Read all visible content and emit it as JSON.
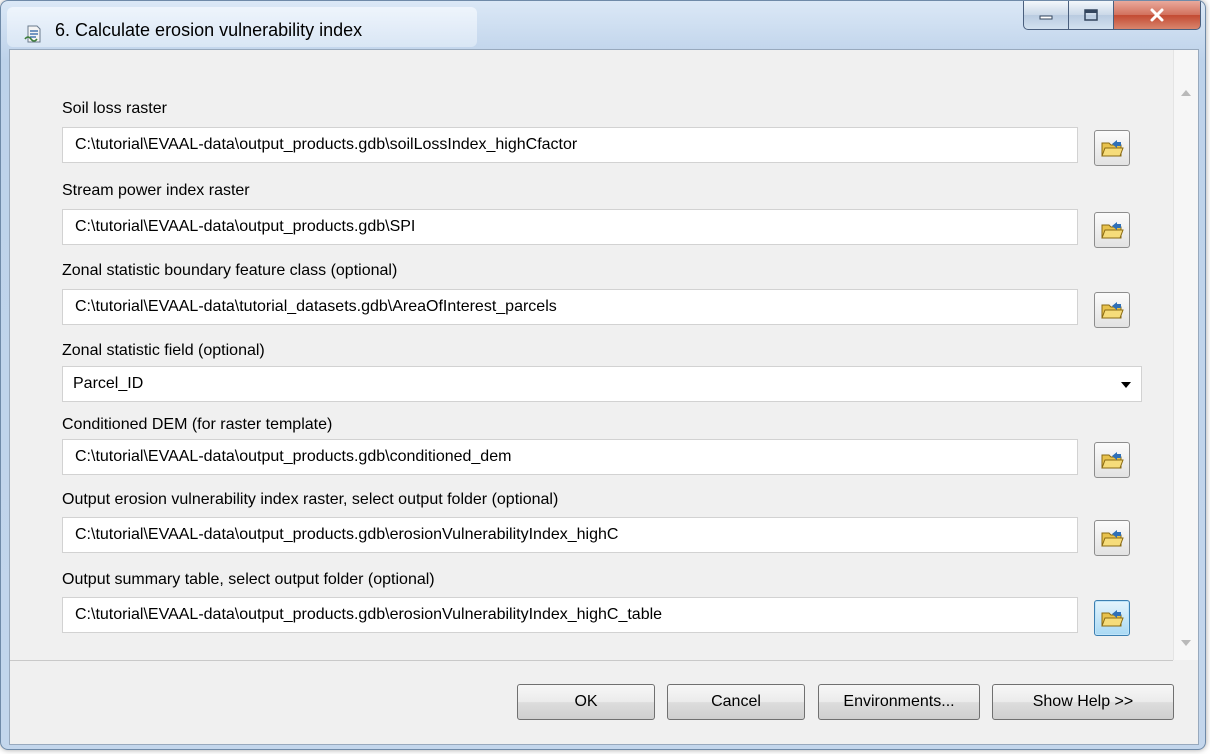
{
  "window": {
    "title": "6. Calculate erosion vulnerability index",
    "controls": {
      "minimize": "minimize",
      "maximize": "maximize",
      "close": "close"
    }
  },
  "params": [
    {
      "label": "Soil loss raster",
      "value": "C:\\tutorial\\EVAAL-data\\output_products.gdb\\soilLossIndex_highCfactor"
    },
    {
      "label": "Stream power index raster",
      "value": "C:\\tutorial\\EVAAL-data\\output_products.gdb\\SPI"
    },
    {
      "label": "Zonal statistic boundary feature class (optional)",
      "value": "C:\\tutorial\\EVAAL-data\\tutorial_datasets.gdb\\AreaOfInterest_parcels"
    },
    {
      "label": "Zonal statistic field (optional)",
      "value": "Parcel_ID"
    },
    {
      "label": "Conditioned DEM (for raster template)",
      "value": "C:\\tutorial\\EVAAL-data\\output_products.gdb\\conditioned_dem"
    },
    {
      "label": "Output erosion vulnerability index raster, select output folder (optional)",
      "value": "C:\\tutorial\\EVAAL-data\\output_products.gdb\\erosionVulnerabilityIndex_highC"
    },
    {
      "label": "Output summary table, select output folder (optional)",
      "value": "C:\\tutorial\\EVAAL-data\\output_products.gdb\\erosionVulnerabilityIndex_highC_table"
    }
  ],
  "buttons": {
    "ok": "OK",
    "cancel": "Cancel",
    "environments": "Environments...",
    "show_help": "Show Help >>"
  },
  "icons": {
    "app": "python-script-icon",
    "browse": "open-folder-icon"
  },
  "colors": {
    "focus_accent": "#3c7fb1",
    "close_button": "#c34a32"
  }
}
